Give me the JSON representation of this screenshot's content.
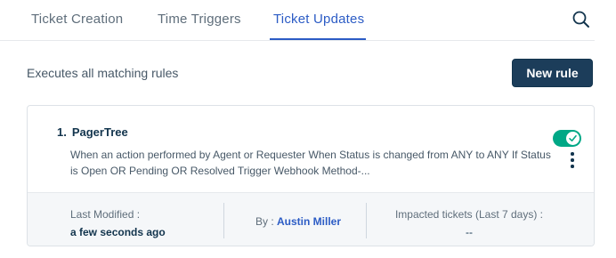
{
  "tabs": [
    {
      "label": "Ticket Creation",
      "active": false
    },
    {
      "label": "Time Triggers",
      "active": false
    },
    {
      "label": "Ticket Updates",
      "active": true
    }
  ],
  "header": {
    "description": "Executes all matching rules",
    "new_rule_label": "New rule"
  },
  "rules": [
    {
      "number": "1.",
      "name": "PagerTree",
      "description": "When an action performed by Agent or Requester When Status is changed from ANY to ANY If Status is Open OR Pending OR Resolved Trigger Webhook Method-...",
      "enabled": true,
      "last_modified_label": "Last Modified :",
      "last_modified_value": "a few seconds ago",
      "by_label": "By :",
      "by_value": "Austin Miller",
      "impacted_label": "Impacted tickets (Last 7 days) :",
      "impacted_value": "--"
    }
  ],
  "colors": {
    "accent": "#2c5cc5",
    "primary_button": "#1c3d5a",
    "toggle_on": "#00a886"
  }
}
